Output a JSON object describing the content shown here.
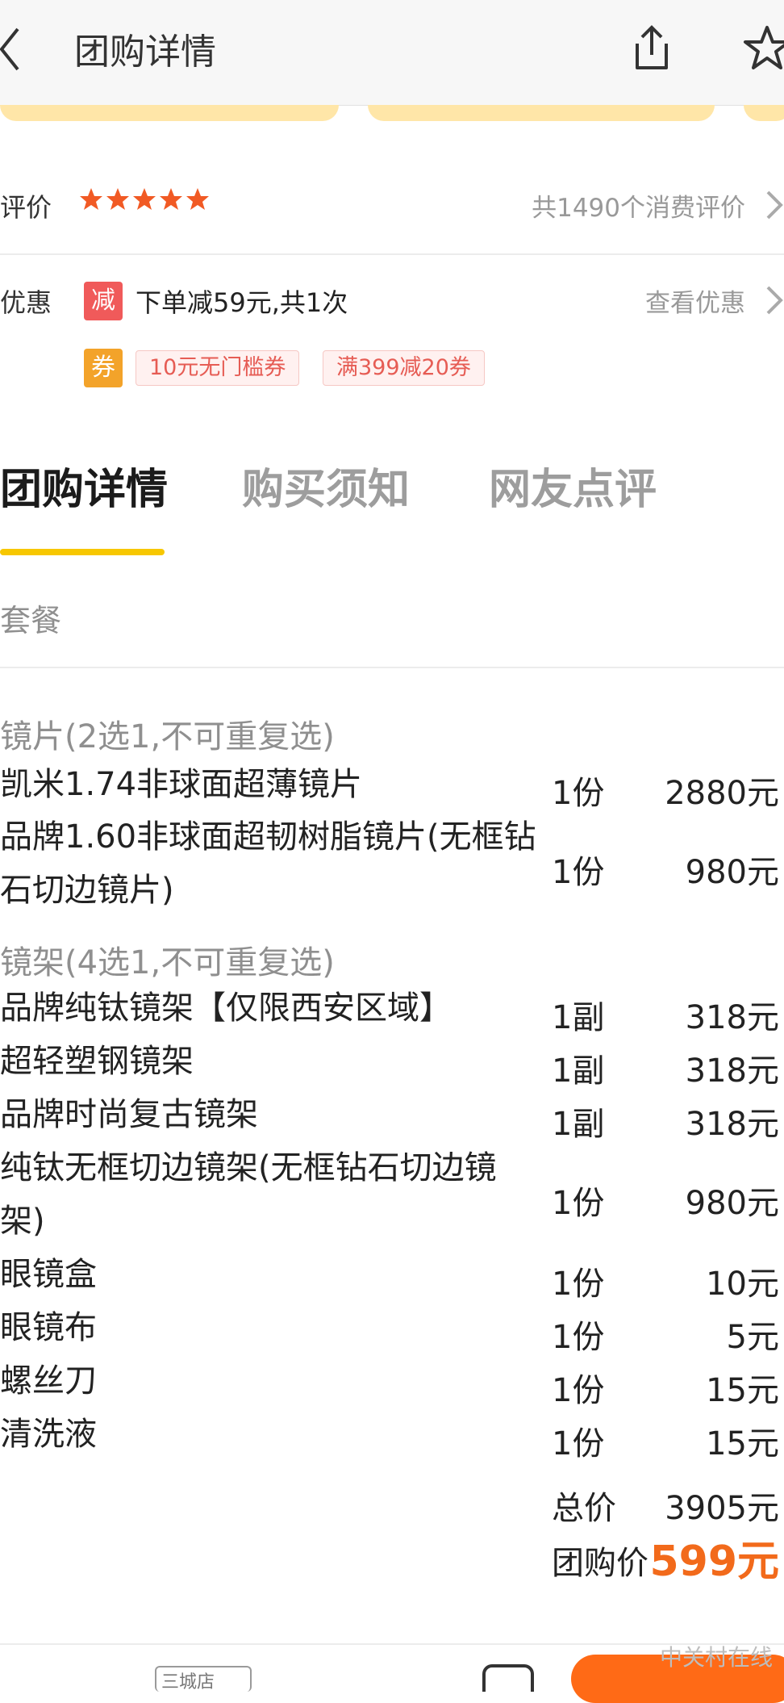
{
  "header": {
    "title": "团购详情"
  },
  "rating": {
    "label": "评价",
    "stars": 5,
    "review_count_text": "共1490个消费评价"
  },
  "promo": {
    "label": "优惠",
    "discount_badge": "减",
    "discount_text": "下单减59元,共1次",
    "view_link": "查看优惠",
    "coupon_badge": "券",
    "coupons": [
      "10元无门槛券",
      "满399减20券"
    ]
  },
  "tabs": [
    "团购详情",
    "购买须知",
    "网友点评"
  ],
  "package": {
    "title": "套餐",
    "lens_section": "镜片(2选1,不可重复选)",
    "lens_items": [
      {
        "name": "凯米1.74非球面超薄镜片",
        "qty": "1份",
        "price": "2880元"
      },
      {
        "name_line1": "品牌1.60非球面超韧树脂镜片(无框钻",
        "name_line2": "石切边镜片)",
        "qty": "1份",
        "price": "980元"
      }
    ],
    "frame_section": "镜架(4选1,不可重复选)",
    "frame_items": [
      {
        "name": "品牌纯钛镜架【仅限西安区域】",
        "qty": "1副",
        "price": "318元"
      },
      {
        "name": "超轻塑钢镜架",
        "qty": "1副",
        "price": "318元"
      },
      {
        "name": "品牌时尚复古镜架",
        "qty": "1副",
        "price": "318元"
      },
      {
        "name_line1": "纯钛无框切边镜架(无框钻石切边镜",
        "name_line2": "架)",
        "qty": "1份",
        "price": "980元"
      }
    ],
    "extra_items": [
      {
        "name": "眼镜盒",
        "qty": "1份",
        "price": "10元"
      },
      {
        "name": "眼镜布",
        "qty": "1份",
        "price": "5元"
      },
      {
        "name": "螺丝刀",
        "qty": "1份",
        "price": "15元"
      },
      {
        "name": "清洗液",
        "qty": "1份",
        "price": "15元"
      }
    ],
    "total_label": "总价",
    "total_value": "3905元",
    "group_price_label": "团购价",
    "group_price_value": "599元"
  },
  "watermark": "中关村在线",
  "bottom_chip_text": "三城店"
}
